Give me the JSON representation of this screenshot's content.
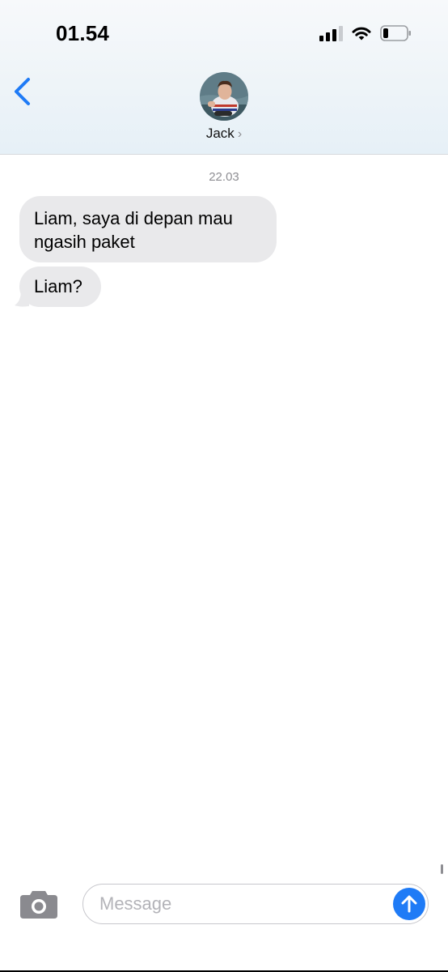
{
  "status_bar": {
    "time": "01.54",
    "icons": [
      "cellular-signal-icon",
      "wifi-icon",
      "battery-icon"
    ]
  },
  "header": {
    "back_icon": "chevron-left-icon",
    "contact_name": "Jack",
    "contact_chevron": "›"
  },
  "conversation": {
    "timestamp": "22.03",
    "messages": [
      {
        "direction": "incoming",
        "text": "Liam, saya di depan mau ngasih paket"
      },
      {
        "direction": "incoming",
        "text": "Liam?"
      }
    ]
  },
  "compose": {
    "camera_icon": "camera-icon",
    "placeholder": "Message",
    "value": "",
    "send_icon": "arrow-up-icon"
  },
  "colors": {
    "accent": "#1f7bf6",
    "incoming_bubble": "#e9e9eb",
    "secondary_text": "#8e8e93"
  }
}
